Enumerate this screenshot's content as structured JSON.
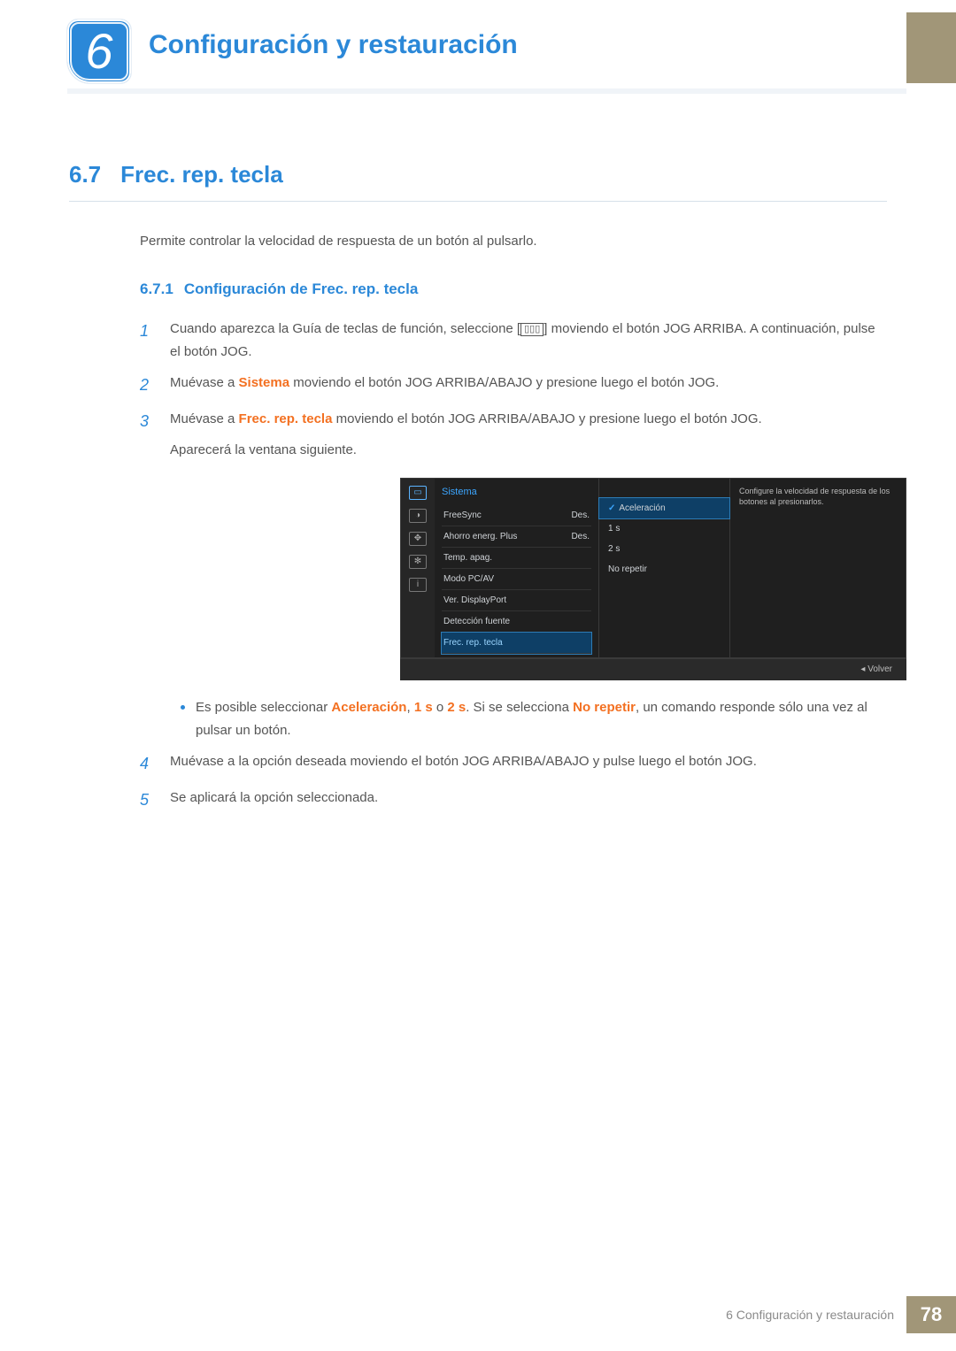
{
  "chapter": {
    "number": "6",
    "title": "Configuración y restauración"
  },
  "section": {
    "number": "6.7",
    "title": "Frec. rep. tecla",
    "intro": "Permite controlar la velocidad de respuesta de un botón al pulsarlo."
  },
  "subsection": {
    "number": "6.7.1",
    "title": "Configuración de Frec. rep. tecla"
  },
  "steps": {
    "s1a": "Cuando aparezca la Guía de teclas de función, seleccione [",
    "s1b": "] moviendo el botón JOG ARRIBA. A continuación, pulse el botón JOG.",
    "s2a": "Muévase a ",
    "s2hl": "Sistema",
    "s2b": " moviendo el botón JOG ARRIBA/ABAJO y presione luego el botón JOG.",
    "s3a": "Muévase a ",
    "s3hl": "Frec. rep. tecla",
    "s3b": " moviendo el botón JOG ARRIBA/ABAJO y presione luego el botón JOG.",
    "s3c": "Aparecerá la ventana siguiente.",
    "bullet_a": "Es posible seleccionar ",
    "bullet_opt1": "Aceleración",
    "bullet_sep1": ", ",
    "bullet_opt2": "1 s",
    "bullet_sep2": " o ",
    "bullet_opt3": "2 s",
    "bullet_mid": ". Si se selecciona ",
    "bullet_opt4": "No repetir",
    "bullet_end": ", un comando responde sólo una vez al pulsar un botón.",
    "s4": "Muévase a la opción deseada moviendo el botón JOG ARRIBA/ABAJO y pulse luego el botón JOG.",
    "s5": "Se aplicará la opción seleccionada."
  },
  "osd": {
    "title": "Sistema",
    "rows": [
      {
        "label": "FreeSync",
        "value": "Des."
      },
      {
        "label": "Ahorro energ. Plus",
        "value": "Des."
      },
      {
        "label": "Temp. apag.",
        "value": ""
      },
      {
        "label": "Modo PC/AV",
        "value": ""
      },
      {
        "label": "Ver. DisplayPort",
        "value": ""
      },
      {
        "label": "Detección fuente",
        "value": ""
      },
      {
        "label": "Frec. rep. tecla",
        "value": ""
      }
    ],
    "options": [
      "Aceleración",
      "1 s",
      "2 s",
      "No repetir"
    ],
    "help": "Configure la velocidad de respuesta de los botones al presionarlos.",
    "back": "Volver"
  },
  "footer": {
    "label": "6 Configuración y restauración",
    "page": "78"
  }
}
